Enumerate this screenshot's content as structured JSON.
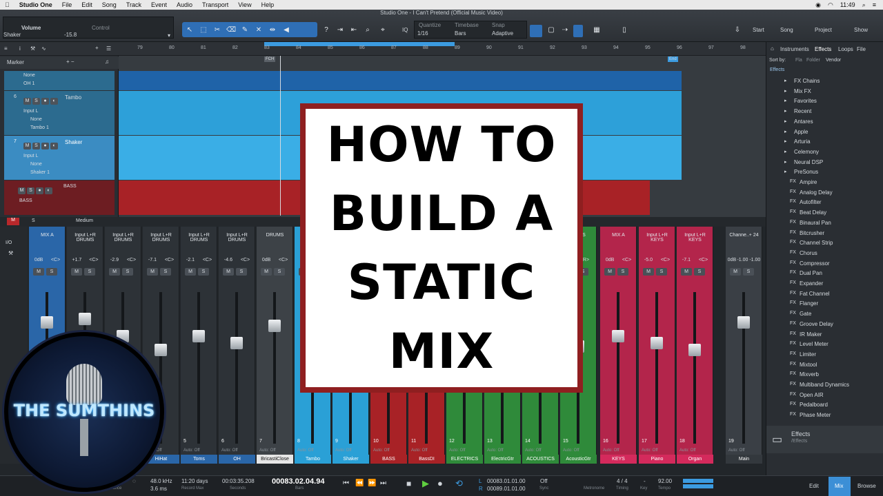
{
  "menubar": {
    "apple": "",
    "items": [
      "Studio One",
      "File",
      "Edit",
      "Song",
      "Track",
      "Event",
      "Audio",
      "Transport",
      "View",
      "Help"
    ],
    "clock": "11:49"
  },
  "window": {
    "title": "Studio One - I Can't Pretend (Official Music Video)"
  },
  "toolbar": {
    "track_info": "Shaker",
    "param": "Volume",
    "param_value": "-15.8",
    "control": "Control",
    "quantize_label": "Quantize",
    "quantize_value": "1/16",
    "timebase_label": "Timebase",
    "timebase_value": "Bars",
    "snap_label": "Snap",
    "snap_value": "Adaptive",
    "iq": "IQ",
    "nav": [
      "Start",
      "Song",
      "Project",
      "Show"
    ]
  },
  "ruler": {
    "bars": [
      "79",
      "80",
      "81",
      "82",
      "83",
      "84",
      "85",
      "86",
      "87",
      "88",
      "89",
      "90",
      "91",
      "92",
      "93",
      "94",
      "95",
      "96",
      "97",
      "98"
    ],
    "marker_label": "Marker",
    "fch": "FCH",
    "end": "End"
  },
  "tracks": [
    {
      "num": "",
      "name": "",
      "input": "None",
      "out": "OH 1"
    },
    {
      "num": "6",
      "name": "Tambo",
      "input": "Input L",
      "mid": "None",
      "out": "Tambo 1"
    },
    {
      "num": "7",
      "name": "Shaker",
      "input": "Input L",
      "mid": "None",
      "out": "Shaker 1"
    },
    {
      "num": "",
      "name": "BASS",
      "input": "BASS"
    }
  ],
  "track_footer": {
    "m": "M",
    "s": "S",
    "size": "Medium"
  },
  "mixer": {
    "io": "I/O",
    "strips": [
      {
        "io": "MIX A",
        "vol": "0dB",
        "pan": "<C>",
        "num": "",
        "name": ""
      },
      {
        "io": "Input L+R DRUMS",
        "vol": "+1.7",
        "pan": "<C>",
        "num": "",
        "name": ""
      },
      {
        "io": "Input L+R DRUMS",
        "vol": "-2.9",
        "pan": "<C>",
        "num": "",
        "name": ""
      },
      {
        "io": "Input L+R DRUMS",
        "vol": "-7.1",
        "pan": "<C>",
        "num": "",
        "name": "HiHat"
      },
      {
        "io": "Input L+R DRUMS",
        "vol": "-2.1",
        "pan": "<C>",
        "num": "5",
        "name": "Toms"
      },
      {
        "io": "Input L+R DRUMS",
        "vol": "-4.6",
        "pan": "<C>",
        "num": "6",
        "name": "OH"
      },
      {
        "io": "DRUMS",
        "vol": "0dB",
        "pan": "<C>",
        "num": "7",
        "name": "BricastiClose"
      },
      {
        "io": "",
        "vol": "",
        "pan": "",
        "num": "8",
        "name": "Tambo"
      },
      {
        "io": "",
        "vol": "",
        "pan": "",
        "num": "9",
        "name": "Shaker"
      },
      {
        "io": "",
        "vol": "",
        "pan": "",
        "num": "10",
        "name": "BASS"
      },
      {
        "io": "",
        "vol": "",
        "pan": "",
        "num": "11",
        "name": "BassDI"
      },
      {
        "io": "",
        "vol": "",
        "pan": "",
        "num": "12",
        "name": "ELECTRICS"
      },
      {
        "io": "",
        "vol": "",
        "pan": "",
        "num": "13",
        "name": "ElectricGtr"
      },
      {
        "io": "",
        "vol": "",
        "pan": "",
        "num": "14",
        "name": "ACOUSTICS"
      },
      {
        "io": "STICS",
        "vol": "",
        "pan": "<R>",
        "num": "15",
        "name": "AcousticGtr"
      },
      {
        "io": "MIX A",
        "vol": "0dB",
        "pan": "<C>",
        "num": "16",
        "name": "KEYS"
      },
      {
        "io": "Input L+R KEYS",
        "vol": "-5.0",
        "pan": "<C>",
        "num": "17",
        "name": "Piano"
      },
      {
        "io": "Input L+R KEYS",
        "vol": "-7.1",
        "pan": "<C>",
        "num": "18",
        "name": "Organ"
      },
      {
        "io": "Channe..+ 24",
        "vol": "0dB",
        "pan": "-1.00  -1.00",
        "num": "19",
        "name": "Main"
      }
    ],
    "auto_off": "Auto: Off"
  },
  "browser": {
    "tabs": [
      "Instruments",
      "Effects",
      "Loops",
      "File"
    ],
    "sort_by": "Sort by:",
    "sort_opts": [
      "Fla",
      "Folder",
      "Vendor"
    ],
    "path": "Effects",
    "items": [
      "FX Chains",
      "Mix FX",
      "Favorites",
      "Recent",
      "Antares",
      "Apple",
      "Arturia",
      "Celemony",
      "Neural DSP",
      "PreSonus",
      "Ampire",
      "Analog Delay",
      "Autofilter",
      "Beat Delay",
      "Binaural Pan",
      "Bitcrusher",
      "Channel Strip",
      "Chorus",
      "Compressor",
      "Dual Pan",
      "Expander",
      "Fat Channel",
      "Flanger",
      "Gate",
      "Groove Delay",
      "IR Maker",
      "Level Meter",
      "Limiter",
      "Mixtool",
      "Mixverb",
      "Multiband Dynamics",
      "Open AIR",
      "Pedalboard",
      "Phase Meter"
    ],
    "footer_title": "Effects",
    "footer_path": "/Effects"
  },
  "transport": {
    "performance": "Performance",
    "rate": "48.0 kHz",
    "latency": "3.6 ms",
    "record_time": "11:20 days",
    "record_label": "Record Max",
    "seconds": "00:03:35.208",
    "seconds_label": "Seconds",
    "bars": "00083.02.04.94",
    "bars_label": "Bars",
    "loop_l": "00083.01.01.00",
    "loop_r": "00089.01.01.00",
    "sync": "Off",
    "sync_label": "Sync",
    "metronome_label": "Metronome",
    "timing": "4 / 4",
    "timing_label": "Timing",
    "key": "-",
    "key_label": "Key",
    "tempo": "92.00",
    "tempo_label": "Tempo",
    "views": [
      "Edit",
      "Mix",
      "Browse"
    ]
  },
  "overlay": {
    "lines": [
      "HOW TO",
      "BUILD A",
      "STATIC",
      "MIX"
    ]
  },
  "logo": {
    "text": "THE SUMTHINS"
  }
}
